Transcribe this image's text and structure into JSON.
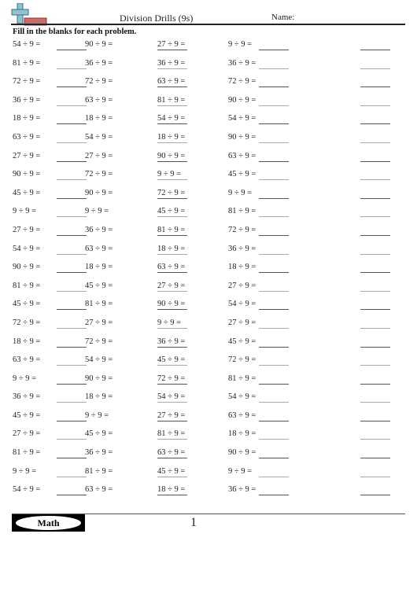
{
  "header": {
    "title": "Division Drills (9s)",
    "name_label": "Name:",
    "logo_icon": "plus-sign-icon"
  },
  "instructions": "Fill in the blanks for each problem.",
  "rows": [
    {
      "c1": "54 ÷ 9 =",
      "c2": "90 ÷ 9 =",
      "c3": "27 ÷ 9 =",
      "c4": "9 ÷ 9 ="
    },
    {
      "c1": "81 ÷ 9 =",
      "c2": "36 ÷ 9 =",
      "c3": "36 ÷ 9 =",
      "c4": "36 ÷ 9 ="
    },
    {
      "c1": "72 ÷ 9 =",
      "c2": "72 ÷ 9 =",
      "c3": "63 ÷ 9 =",
      "c4": "72 ÷ 9 ="
    },
    {
      "c1": "36 ÷ 9 =",
      "c2": "63 ÷ 9 =",
      "c3": "81 ÷ 9 =",
      "c4": "90 ÷ 9 ="
    },
    {
      "c1": "18 ÷ 9 =",
      "c2": "18 ÷ 9 =",
      "c3": "54 ÷ 9 =",
      "c4": "54 ÷ 9 ="
    },
    {
      "c1": "63 ÷ 9 =",
      "c2": "54 ÷ 9 =",
      "c3": "18 ÷ 9 =",
      "c4": "90 ÷ 9 ="
    },
    {
      "c1": "27 ÷ 9 =",
      "c2": "27 ÷ 9 =",
      "c3": "90 ÷ 9 =",
      "c4": "63 ÷ 9 ="
    },
    {
      "c1": "90 ÷ 9 =",
      "c2": "72 ÷ 9 =",
      "c3": "9 ÷ 9 =",
      "c4": "45 ÷ 9 ="
    },
    {
      "c1": "45 ÷ 9 =",
      "c2": "90 ÷ 9 =",
      "c3": "72 ÷ 9 =",
      "c4": "9 ÷ 9 ="
    },
    {
      "c1": "9 ÷ 9 =",
      "c2": "9 ÷ 9 =",
      "c3": "45 ÷ 9 =",
      "c4": "81 ÷ 9 ="
    },
    {
      "c1": "27 ÷ 9 =",
      "c2": "36 ÷ 9 =",
      "c3": "81 ÷ 9 =",
      "c4": "72 ÷ 9 ="
    },
    {
      "c1": "54 ÷ 9 =",
      "c2": "63 ÷ 9 =",
      "c3": "18 ÷ 9 =",
      "c4": "36 ÷ 9 ="
    },
    {
      "c1": "90 ÷ 9 =",
      "c2": "18 ÷ 9 =",
      "c3": "63 ÷ 9 =",
      "c4": "18 ÷ 9 ="
    },
    {
      "c1": "81 ÷ 9 =",
      "c2": "45 ÷ 9 =",
      "c3": "27 ÷ 9 =",
      "c4": "27 ÷ 9 ="
    },
    {
      "c1": "45 ÷ 9 =",
      "c2": "81 ÷ 9 =",
      "c3": "90 ÷ 9 =",
      "c4": "54 ÷ 9 ="
    },
    {
      "c1": "72 ÷ 9 =",
      "c2": "27 ÷ 9 =",
      "c3": "9 ÷ 9 =",
      "c4": "27 ÷ 9 ="
    },
    {
      "c1": "18 ÷ 9 =",
      "c2": "72 ÷ 9 =",
      "c3": "36 ÷ 9 =",
      "c4": "45 ÷ 9 ="
    },
    {
      "c1": "63 ÷ 9 =",
      "c2": "54 ÷ 9 =",
      "c3": "45 ÷ 9 =",
      "c4": "72 ÷ 9 ="
    },
    {
      "c1": "9 ÷ 9 =",
      "c2": "90 ÷ 9 =",
      "c3": "72 ÷ 9 =",
      "c4": "81 ÷ 9 ="
    },
    {
      "c1": "36 ÷ 9 =",
      "c2": "18 ÷ 9 =",
      "c3": "54 ÷ 9 =",
      "c4": "54 ÷ 9 ="
    },
    {
      "c1": "45 ÷ 9 =",
      "c2": "9 ÷ 9 =",
      "c3": "27 ÷ 9 =",
      "c4": "63 ÷ 9 ="
    },
    {
      "c1": "27 ÷ 9 =",
      "c2": "45 ÷ 9 =",
      "c3": "81 ÷ 9 =",
      "c4": "18 ÷ 9 ="
    },
    {
      "c1": "81 ÷ 9 =",
      "c2": "36 ÷ 9 =",
      "c3": "63 ÷ 9 =",
      "c4": "90 ÷ 9 ="
    },
    {
      "c1": "9 ÷ 9 =",
      "c2": "81 ÷ 9 =",
      "c3": "45 ÷ 9 =",
      "c4": "9 ÷ 9 ="
    },
    {
      "c1": "54 ÷ 9 =",
      "c2": "63 ÷ 9 =",
      "c3": "18 ÷ 9 =",
      "c4": "36 ÷ 9 ="
    }
  ],
  "footer": {
    "badge_label": "Math",
    "page_number": "1"
  }
}
